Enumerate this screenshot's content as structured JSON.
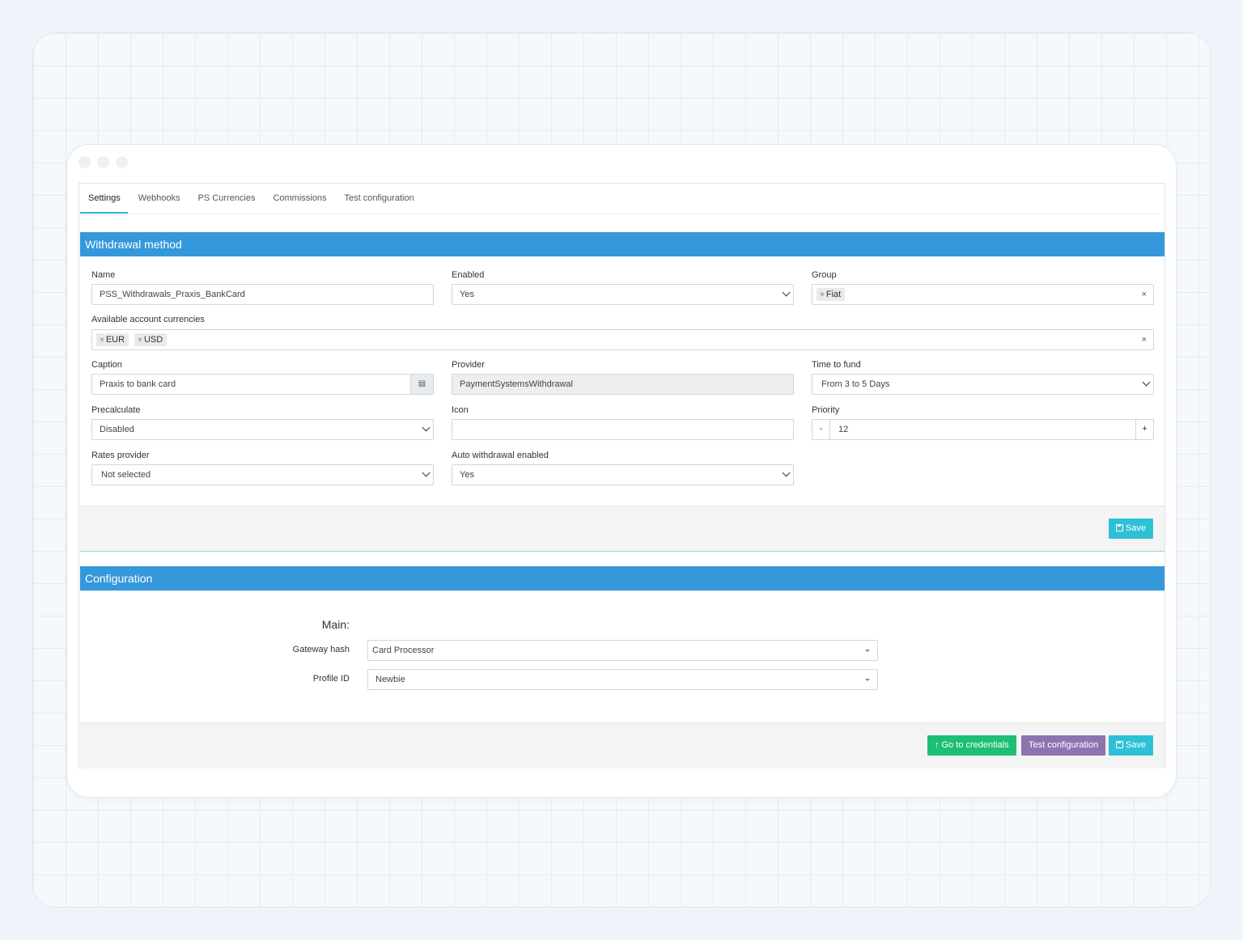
{
  "tabs": [
    {
      "label": "Settings",
      "active": true
    },
    {
      "label": "Webhooks"
    },
    {
      "label": "PS Currencies"
    },
    {
      "label": "Commissions"
    },
    {
      "label": "Test configuration"
    }
  ],
  "withdrawal": {
    "title": "Withdrawal method",
    "name": {
      "label": "Name",
      "value": "PSS_Withdrawals_Praxis_BankCard"
    },
    "enabled": {
      "label": "Enabled",
      "value": "Yes"
    },
    "group": {
      "label": "Group",
      "tags": [
        "Fiat"
      ],
      "clear": "×"
    },
    "currencies": {
      "label": "Available account currencies",
      "tags": [
        "EUR",
        "USD"
      ],
      "clear": "×"
    },
    "caption": {
      "label": "Caption",
      "value": "Praxis to bank card"
    },
    "provider": {
      "label": "Provider",
      "value": "PaymentSystemsWithdrawal"
    },
    "time_to_fund": {
      "label": "Time to fund",
      "value": "From 3 to 5 Days"
    },
    "precalculate": {
      "label": "Precalculate",
      "value": "Disabled"
    },
    "icon": {
      "label": "Icon",
      "value": ""
    },
    "priority": {
      "label": "Priority",
      "value": "12",
      "minus": "-",
      "plus": "+"
    },
    "rates_provider": {
      "label": "Rates provider",
      "value": "Not selected"
    },
    "auto_withdrawal": {
      "label": "Auto withdrawal enabled",
      "value": "Yes"
    },
    "save_label": "Save"
  },
  "configuration": {
    "title": "Configuration",
    "section_label": "Main:",
    "gateway_hash": {
      "label": "Gateway hash",
      "value": "Card Processor"
    },
    "profile_id": {
      "label": "Profile ID",
      "value": "Newbie"
    },
    "go_credentials_label": "Go to credentials",
    "test_config_label": "Test configuration",
    "save_label": "Save"
  },
  "colors": {
    "header": "#3498db",
    "tab_accent": "#2db5d4",
    "save": "#2ec1d6",
    "credentials": "#1dbf73",
    "test": "#8e73b1"
  }
}
